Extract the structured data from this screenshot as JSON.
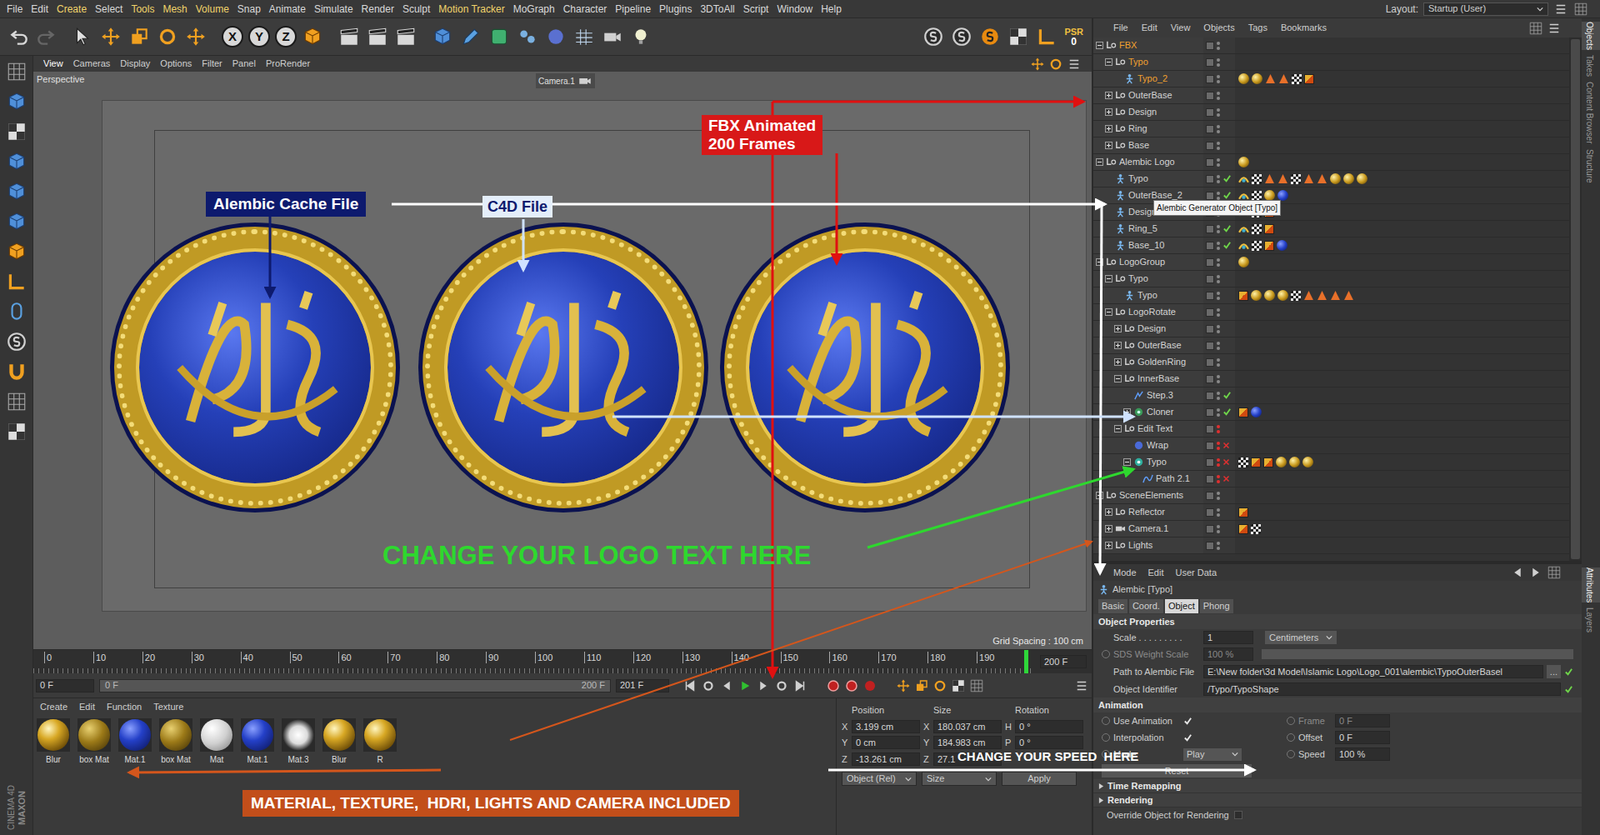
{
  "menubar": {
    "items": [
      {
        "label": "File",
        "highlighted": false
      },
      {
        "label": "Edit",
        "highlighted": false
      },
      {
        "label": "Create",
        "highlighted": true
      },
      {
        "label": "Select",
        "highlighted": false
      },
      {
        "label": "Tools",
        "highlighted": true
      },
      {
        "label": "Mesh",
        "highlighted": true
      },
      {
        "label": "Volume",
        "highlighted": true
      },
      {
        "label": "Snap",
        "highlighted": false
      },
      {
        "label": "Animate",
        "highlighted": false
      },
      {
        "label": "Simulate",
        "highlighted": false
      },
      {
        "label": "Render",
        "highlighted": false
      },
      {
        "label": "Sculpt",
        "highlighted": false
      },
      {
        "label": "Motion Tracker",
        "highlighted": true
      },
      {
        "label": "MoGraph",
        "highlighted": false
      },
      {
        "label": "Character",
        "highlighted": false
      },
      {
        "label": "Pipeline",
        "highlighted": false
      },
      {
        "label": "Plugins",
        "highlighted": false
      },
      {
        "label": "3DToAll",
        "highlighted": false
      },
      {
        "label": "Script",
        "highlighted": false
      },
      {
        "label": "Window",
        "highlighted": false
      },
      {
        "label": "Help",
        "highlighted": false
      }
    ],
    "layout_label": "Layout:",
    "layout_value": "Startup (User)"
  },
  "toolbar": {
    "axes": [
      "X",
      "Y",
      "Z"
    ],
    "psr_label": "PSR",
    "psr_value": "0"
  },
  "brand": {
    "line1": "MAXON",
    "line2": "CINEMA 4D"
  },
  "viewport": {
    "menu": [
      "View",
      "Cameras",
      "Display",
      "Options",
      "Filter",
      "Panel",
      "ProRender"
    ],
    "view_name": "Perspective",
    "camera": "Camera.1",
    "grid_spacing": "Grid Spacing : 100 cm"
  },
  "annotations": {
    "fbx": [
      "FBX Animated",
      "200 Frames"
    ],
    "alembic": "Alembic Cache File",
    "c4d": "C4D File",
    "logo_text": "CHANGE YOUR LOGO TEXT HERE",
    "speed": "CHANGE YOUR SPEED  HERE",
    "materials": "MATERIAL, TEXTURE,  HDRI, LIGHTS AND CAMERA INCLUDED"
  },
  "timeline": {
    "ticks": [
      "0",
      "10",
      "20",
      "30",
      "40",
      "50",
      "60",
      "70",
      "80",
      "90",
      "100",
      "110",
      "120",
      "130",
      "140",
      "150",
      "160",
      "170",
      "180",
      "190"
    ],
    "playhead_level": 1,
    "end_field": "200 F"
  },
  "playback": {
    "current": "0 F",
    "range_start": "0 F",
    "range_end": "200 F",
    "max": "201 F"
  },
  "materials": {
    "menu": [
      "Create",
      "Edit",
      "Function",
      "Texture"
    ],
    "items": [
      {
        "name": "Blur",
        "kind": "gold"
      },
      {
        "name": "box Mat",
        "kind": "goldtex"
      },
      {
        "name": "Mat.1",
        "kind": "blue"
      },
      {
        "name": "box Mat",
        "kind": "goldtex"
      },
      {
        "name": "Mat",
        "kind": "white"
      },
      {
        "name": "Mat.1",
        "kind": "blue"
      },
      {
        "name": "Mat.3",
        "kind": "chrome"
      },
      {
        "name": "Blur",
        "kind": "gold"
      },
      {
        "name": "R",
        "kind": "gold"
      }
    ]
  },
  "coordinates": {
    "headers": [
      "Position",
      "Size",
      "Rotation"
    ],
    "rows": [
      [
        {
          "axis": "X",
          "value": "3.199 cm"
        },
        {
          "axis": "X",
          "value": "180.037 cm"
        },
        {
          "axis": "H",
          "value": "0 °"
        }
      ],
      [
        {
          "axis": "Y",
          "value": "0 cm"
        },
        {
          "axis": "Y",
          "value": "184.983 cm"
        },
        {
          "axis": "P",
          "value": "0 °"
        }
      ],
      [
        {
          "axis": "Z",
          "value": "-13.261 cm"
        },
        {
          "axis": "Z",
          "value": "27.1"
        }
      ]
    ],
    "buttons": [
      {
        "label": "Object (Rel)",
        "dropdown": true
      },
      {
        "label": "Size",
        "dropdown": true
      },
      {
        "label": "Apply",
        "dropdown": false
      }
    ]
  },
  "object_manager": {
    "menu": [
      "File",
      "Edit",
      "View",
      "Objects",
      "Tags",
      "Bookmarks"
    ],
    "tooltip": "Alembic Generator Object [Typo]",
    "rows": [
      {
        "name": "FBX",
        "level": 0,
        "icon": "null",
        "expander": "open",
        "highlighted": true,
        "status": "none",
        "red_dots": false,
        "tags": []
      },
      {
        "name": "Typo",
        "level": 1,
        "icon": "null",
        "expander": "open",
        "highlighted": true,
        "status": "none",
        "red_dots": false,
        "tags": []
      },
      {
        "name": "Typo_2",
        "level": 2,
        "icon": "alembic",
        "expander": "none",
        "highlighted": true,
        "status": "none",
        "red_dots": false,
        "tags": [
          "gold",
          "gold",
          "cone",
          "cone",
          "checker",
          "tex"
        ]
      },
      {
        "name": "OuterBase",
        "level": 1,
        "icon": "null",
        "expander": "closed",
        "highlighted": false,
        "status": "none",
        "red_dots": false,
        "tags": []
      },
      {
        "name": "Design",
        "level": 1,
        "icon": "null",
        "expander": "closed",
        "highlighted": false,
        "status": "none",
        "red_dots": false,
        "tags": []
      },
      {
        "name": "Ring",
        "level": 1,
        "icon": "null",
        "expander": "closed",
        "highlighted": false,
        "status": "none",
        "red_dots": false,
        "tags": []
      },
      {
        "name": "Base",
        "level": 1,
        "icon": "null",
        "expander": "closed",
        "highlighted": false,
        "status": "none",
        "red_dots": false,
        "tags": []
      },
      {
        "name": "Alembic Logo",
        "level": 0,
        "icon": "null",
        "expander": "open",
        "highlighted": false,
        "status": "none",
        "red_dots": false,
        "tags": [
          "gold"
        ]
      },
      {
        "name": "Typo",
        "level": 1,
        "icon": "alembic",
        "expander": "none",
        "highlighted": false,
        "status": "check",
        "red_dots": false,
        "tags": [
          "phong",
          "checker",
          "cone",
          "cone",
          "checker",
          "cone",
          "cone",
          "gold",
          "gold",
          "gold"
        ]
      },
      {
        "name": "OuterBase_2",
        "level": 1,
        "icon": "alembic",
        "expander": "none",
        "highlighted": false,
        "status": "check",
        "red_dots": false,
        "tags": [
          "phong",
          "checker",
          "gold",
          "blue"
        ]
      },
      {
        "name": "Design",
        "level": 1,
        "icon": "alembic",
        "expander": "none",
        "highlighted": false,
        "status": "check",
        "red_dots": false,
        "tags": [
          "phong",
          "checker",
          "tex"
        ]
      },
      {
        "name": "Ring_5",
        "level": 1,
        "icon": "alembic",
        "expander": "none",
        "highlighted": false,
        "status": "check",
        "red_dots": false,
        "tags": [
          "phong",
          "checker",
          "tex"
        ]
      },
      {
        "name": "Base_10",
        "level": 1,
        "icon": "alembic",
        "expander": "none",
        "highlighted": false,
        "status": "check",
        "red_dots": false,
        "tags": [
          "phong",
          "checker",
          "tex",
          "blue"
        ]
      },
      {
        "name": "LogoGroup",
        "level": 0,
        "icon": "null",
        "expander": "open",
        "highlighted": false,
        "status": "none",
        "red_dots": false,
        "tags": [
          "gold"
        ]
      },
      {
        "name": "Typo",
        "level": 1,
        "icon": "null",
        "expander": "open",
        "highlighted": false,
        "status": "none",
        "red_dots": false,
        "tags": []
      },
      {
        "name": "Typo",
        "level": 2,
        "icon": "alembic",
        "expander": "none",
        "highlighted": false,
        "status": "none",
        "red_dots": false,
        "tags": [
          "tex",
          "gold",
          "gold",
          "gold",
          "checker",
          "cone",
          "cone",
          "cone",
          "cone"
        ]
      },
      {
        "name": "LogoRotate",
        "level": 1,
        "icon": "null",
        "expander": "open",
        "highlighted": false,
        "status": "none",
        "red_dots": false,
        "tags": []
      },
      {
        "name": "Design",
        "level": 2,
        "icon": "null",
        "expander": "closed",
        "highlighted": false,
        "status": "none",
        "red_dots": false,
        "tags": []
      },
      {
        "name": "OuterBase",
        "level": 2,
        "icon": "null",
        "expander": "closed",
        "highlighted": false,
        "status": "none",
        "red_dots": false,
        "tags": []
      },
      {
        "name": "GoldenRing",
        "level": 2,
        "icon": "null",
        "expander": "closed",
        "highlighted": false,
        "status": "none",
        "red_dots": false,
        "tags": []
      },
      {
        "name": "InnerBase",
        "level": 2,
        "icon": "null",
        "expander": "open",
        "highlighted": false,
        "status": "none",
        "red_dots": false,
        "tags": []
      },
      {
        "name": "Step.3",
        "level": 3,
        "icon": "step",
        "expander": "none",
        "highlighted": false,
        "status": "check",
        "red_dots": false,
        "tags": []
      },
      {
        "name": "Cloner",
        "level": 3,
        "icon": "cloner",
        "expander": "closed",
        "highlighted": false,
        "status": "check",
        "red_dots": false,
        "tags": [
          "tex",
          "blue"
        ]
      },
      {
        "name": "Edit Text",
        "level": 2,
        "icon": "null",
        "expander": "open",
        "highlighted": false,
        "status": "none",
        "red_dots": true,
        "tags": []
      },
      {
        "name": "Wrap",
        "level": 3,
        "icon": "deformer",
        "expander": "none",
        "highlighted": false,
        "status": "cross",
        "red_dots": true,
        "tags": []
      },
      {
        "name": "Typo",
        "level": 3,
        "icon": "text",
        "expander": "open",
        "highlighted": false,
        "status": "cross",
        "red_dots": true,
        "tags": [
          "checker",
          "tex",
          "tex",
          "gold",
          "gold",
          "gold"
        ]
      },
      {
        "name": "Path 2.1",
        "level": 4,
        "icon": "spline",
        "expander": "none",
        "highlighted": false,
        "status": "cross",
        "red_dots": true,
        "tags": []
      },
      {
        "name": "SceneElements",
        "level": 0,
        "icon": "null",
        "expander": "open",
        "highlighted": false,
        "status": "none",
        "red_dots": false,
        "tags": []
      },
      {
        "name": "Reflector",
        "level": 1,
        "icon": "null",
        "expander": "closed",
        "highlighted": false,
        "status": "none",
        "red_dots": false,
        "tags": [
          "tex"
        ]
      },
      {
        "name": "Camera.1",
        "level": 1,
        "icon": "camera",
        "expander": "closed",
        "highlighted": false,
        "status": "none",
        "red_dots": false,
        "tags": [
          "tex",
          "checker"
        ]
      },
      {
        "name": "Lights",
        "level": 1,
        "icon": "null",
        "expander": "closed",
        "highlighted": false,
        "status": "none",
        "red_dots": false,
        "tags": []
      }
    ]
  },
  "attributes": {
    "menu": [
      "Mode",
      "Edit",
      "User Data"
    ],
    "title": "Alembic [Typo]",
    "tabs": [
      {
        "label": "Basic",
        "selected": false
      },
      {
        "label": "Coord.",
        "selected": false
      },
      {
        "label": "Object",
        "selected": true
      },
      {
        "label": "Phong",
        "selected": false
      }
    ],
    "section": "Object Properties",
    "scale": {
      "label": "Scale . . . . . . . . .",
      "value": "1",
      "unit": "Centimeters"
    },
    "sds": {
      "label": "SDS Weight Scale",
      "value": "100 %",
      "disabled": true,
      "level": 1
    },
    "path": {
      "label": "Path to Alembic File",
      "value": "E:\\New folder\\3d Model\\Islamic Logo\\Logo_001\\alembic\\TypoOuterBasel",
      "browse": "...",
      "valid": true
    },
    "identifier": {
      "label": "Object Identifier",
      "value": "/Typo/TypoShape",
      "valid": true
    },
    "animation_title": "Animation",
    "anim_rows": [
      {
        "left": {
          "kind": "check",
          "label": "Use Animation",
          "checked": true
        },
        "right": {
          "label": "Frame",
          "value": "0 F",
          "disabled": true
        }
      },
      {
        "left": {
          "kind": "check",
          "label": "Interpolation",
          "checked": true
        },
        "right": {
          "label": "Offset",
          "value": "0 F",
          "disabled": false
        }
      },
      {
        "left": {
          "kind": "dropdown",
          "label": "Mode",
          "value": "Play"
        },
        "right": {
          "label": "Speed",
          "value": "100 %",
          "disabled": false
        }
      }
    ],
    "reset": "Reset",
    "collapsed_sections": [
      "Time Remapping",
      "Rendering"
    ],
    "override": {
      "label": "Override Object for Rendering",
      "checked": false
    }
  },
  "side_tabs": {
    "top": [
      {
        "label": "Objects",
        "selected": true
      },
      {
        "label": "Takes",
        "selected": false
      },
      {
        "label": "Content Browser",
        "selected": false
      },
      {
        "label": "Structure",
        "selected": false
      }
    ],
    "bottom": [
      {
        "label": "Attributes",
        "selected": true
      },
      {
        "label": "Layers",
        "selected": false
      }
    ]
  }
}
